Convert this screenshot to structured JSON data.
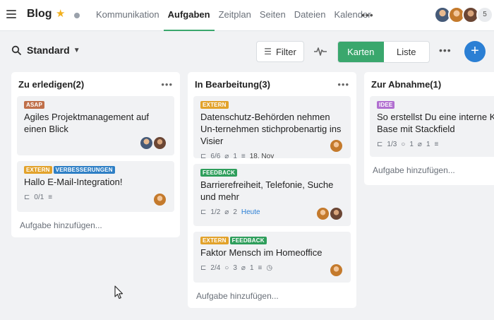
{
  "header": {
    "app_title": "Blog",
    "nav": [
      "Kommunikation",
      "Aufgaben",
      "Zeitplan",
      "Seiten",
      "Dateien",
      "Kalender"
    ],
    "active_nav": "Aufgaben",
    "more": "•••",
    "avatar_count": "5"
  },
  "toolbar": {
    "view_name": "Standard",
    "filter_label": "Filter",
    "view_cards": "Karten",
    "view_list": "Liste",
    "more": "•••",
    "add_symbol": "+"
  },
  "colors": {
    "accent_green": "#3aa76d",
    "accent_blue": "#2b7fd4",
    "tag_asap": "#c0704a",
    "tag_extern": "#e2a22b",
    "tag_verbesserungen": "#2e7fc5",
    "tag_feedback": "#2e9e5b",
    "tag_idee": "#b16fd0"
  },
  "columns": [
    {
      "title": "Zu erledigen(2)",
      "more": "•••",
      "add_task": "Aufgabe hinzufügen...",
      "cards": [
        {
          "tags": [
            "ASAP"
          ],
          "title": "Agiles Projektmanagement auf einen Blick"
        },
        {
          "tags": [
            "EXTERN",
            "VERBESSERUNGEN"
          ],
          "title": "Hallo E-Mail-Integration!",
          "subtasks": "0/1"
        }
      ]
    },
    {
      "title": "In Bearbeitung(3)",
      "more": "•••",
      "add_task": "Aufgabe hinzufügen...",
      "cards": [
        {
          "tags": [
            "EXTERN"
          ],
          "title": "Datenschutz-Behörden nehmen Un-ternehmen stichprobenartig ins Visier",
          "subtasks": "6/6",
          "attachments": "1",
          "due": "18. Nov"
        },
        {
          "tags": [
            "FEEDBACK"
          ],
          "title": "Barrierefreiheit, Telefonie, Suche und mehr",
          "subtasks": "1/2",
          "attachments": "2",
          "due": "Heute"
        },
        {
          "tags": [
            "EXTERN",
            "FEEDBACK"
          ],
          "title": "Faktor Mensch im Homeoffice",
          "subtasks": "2/4",
          "comments": "3",
          "attachments": "1"
        }
      ]
    },
    {
      "title": "Zur Abnahme(1)",
      "more": "•••",
      "add_task": "Aufgabe hinzufügen...",
      "cards": [
        {
          "tags": [
            "IDEE"
          ],
          "title": "So erstellst Du eine interne Kn Base mit Stackfield",
          "subtasks": "1/3",
          "comments": "1",
          "attachments": "1"
        }
      ]
    }
  ]
}
